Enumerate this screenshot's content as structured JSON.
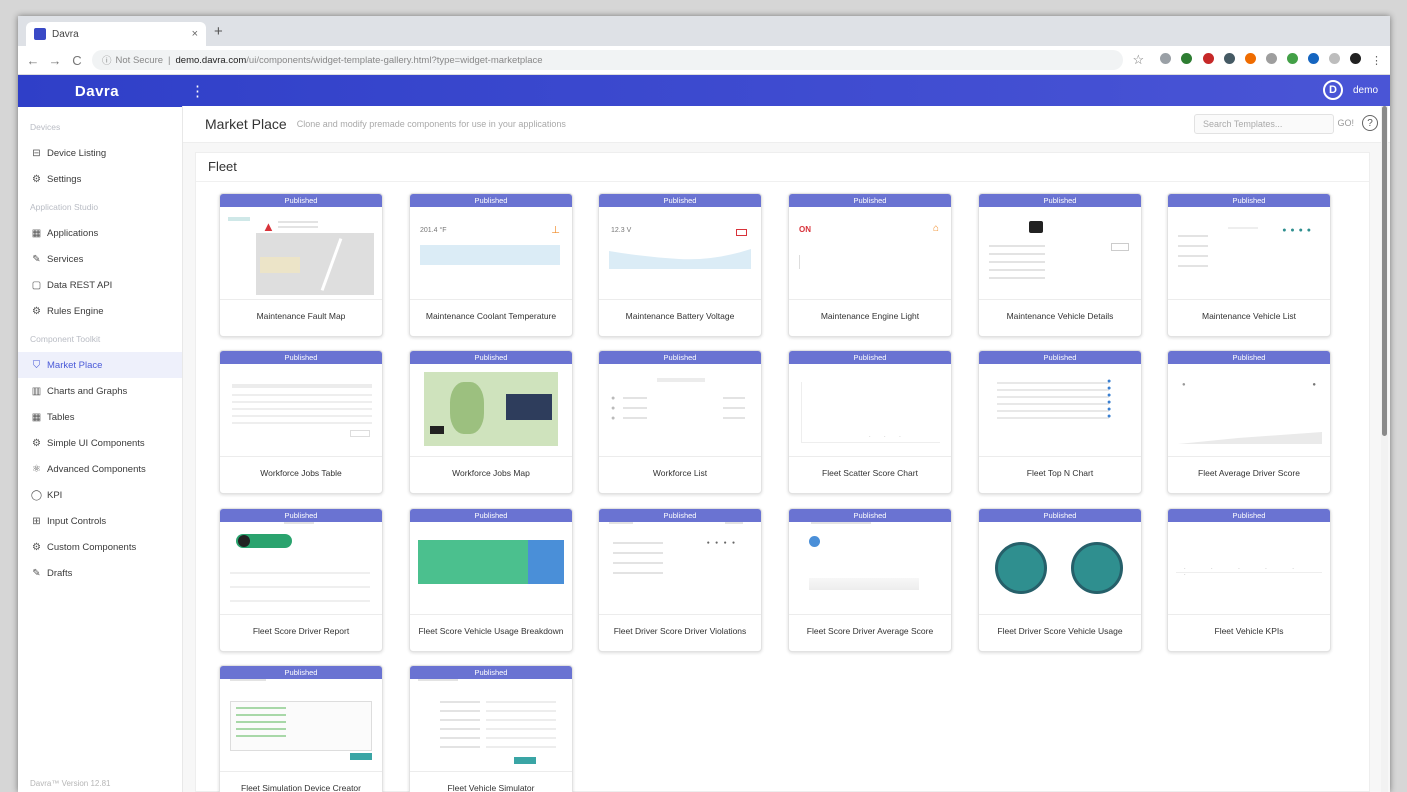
{
  "browser": {
    "tab_title": "Davra",
    "tab_close": "×",
    "new_tab": "+",
    "back": "←",
    "forward": "→",
    "reload": "C",
    "security_label": "Not Secure",
    "url_host": "demo.davra.com",
    "url_path": "/ui/components/widget-template-gallery.html?type=widget-marketplace",
    "star": "☆"
  },
  "header": {
    "logo": "Davra",
    "menu": "⋮",
    "avatar_letter": "D",
    "user": "demo"
  },
  "sidebar": {
    "sections": [
      {
        "title": "Devices",
        "items": [
          {
            "label": "Device Listing",
            "icon": "⊟"
          },
          {
            "label": "Settings",
            "icon": "⚙"
          }
        ]
      },
      {
        "title": "Application Studio",
        "items": [
          {
            "label": "Applications",
            "icon": "▦"
          },
          {
            "label": "Services",
            "icon": "✎"
          },
          {
            "label": "Data REST API",
            "icon": "▢"
          },
          {
            "label": "Rules Engine",
            "icon": "⚙"
          }
        ]
      },
      {
        "title": "Component Toolkit",
        "items": [
          {
            "label": "Market Place",
            "icon": "⛉",
            "active": true
          },
          {
            "label": "Charts and Graphs",
            "icon": "▥"
          },
          {
            "label": "Tables",
            "icon": "▦"
          },
          {
            "label": "Simple UI Components",
            "icon": "⚙"
          },
          {
            "label": "Advanced Components",
            "icon": "⚛"
          },
          {
            "label": "KPI",
            "icon": "◯"
          },
          {
            "label": "Input Controls",
            "icon": "⊞"
          },
          {
            "label": "Custom Components",
            "icon": "⚙"
          },
          {
            "label": "Drafts",
            "icon": "✎"
          }
        ]
      }
    ],
    "footer": "Davra™ Version 12.81"
  },
  "page": {
    "title": "Market Place",
    "subtitle": "Clone and modify premade components for use in your applications",
    "search_placeholder": "Search Templates...",
    "go": "GO!",
    "help": "?"
  },
  "panel": {
    "title": "Fleet",
    "badge": "Published"
  },
  "cards": [
    {
      "name": "Maintenance Fault Map",
      "thumb": "map"
    },
    {
      "name": "Maintenance Coolant Temperature",
      "thumb": "coolant",
      "value": "201.4 °F"
    },
    {
      "name": "Maintenance Battery Voltage",
      "thumb": "battery",
      "value": "12.3 V"
    },
    {
      "name": "Maintenance Engine Light",
      "thumb": "engine",
      "value": "ON"
    },
    {
      "name": "Maintenance Vehicle Details",
      "thumb": "details"
    },
    {
      "name": "Maintenance Vehicle List",
      "thumb": "list"
    },
    {
      "name": "Workforce Jobs Table",
      "thumb": "table"
    },
    {
      "name": "Workforce Jobs Map",
      "thumb": "jobsmap"
    },
    {
      "name": "Workforce List",
      "thumb": "wlist"
    },
    {
      "name": "Fleet Scatter Score Chart",
      "thumb": "scatter"
    },
    {
      "name": "Fleet Top N Chart",
      "thumb": "topn"
    },
    {
      "name": "Fleet Average Driver Score",
      "thumb": "avg"
    },
    {
      "name": "Fleet Score Driver Report",
      "thumb": "report"
    },
    {
      "name": "Fleet Score Vehicle Usage Breakdown",
      "thumb": "breakdown"
    },
    {
      "name": "Fleet Driver Score Driver Violations",
      "thumb": "violations"
    },
    {
      "name": "Fleet Score Driver Average Score",
      "thumb": "driveravg"
    },
    {
      "name": "Fleet Driver Score Vehicle Usage",
      "thumb": "circles"
    },
    {
      "name": "Fleet Vehicle KPIs",
      "thumb": "kpis"
    },
    {
      "name": "Fleet Simulation Device Creator",
      "thumb": "code"
    },
    {
      "name": "Fleet Vehicle Simulator",
      "thumb": "form"
    }
  ],
  "colors": {
    "brand": "#3a47cc",
    "badge": "#6a73d2",
    "teal": "#2f8f8f",
    "green_block": "#4bc08e",
    "blue_block": "#4a8fd8",
    "alert_red": "#d8323a",
    "orange": "#f08a24"
  }
}
